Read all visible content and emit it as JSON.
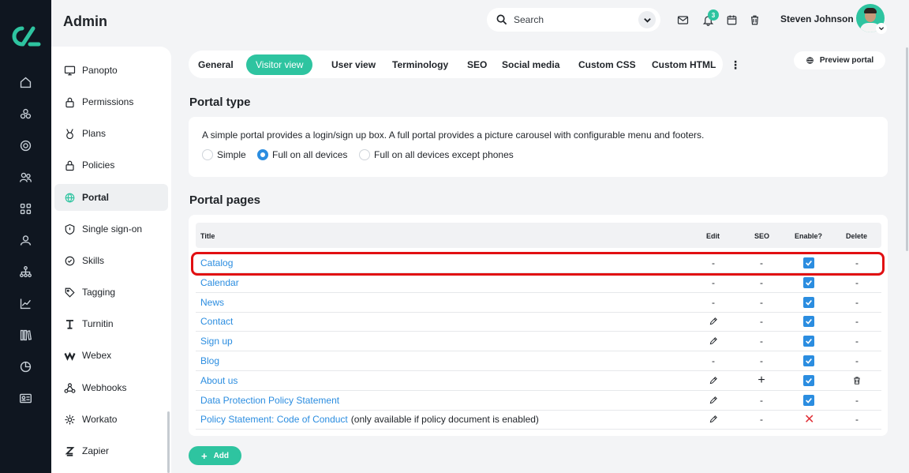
{
  "header": {
    "title": "Admin",
    "search_placeholder": "Search",
    "notifications_count": "3",
    "user_name": "Steven Johnson"
  },
  "rail_icons": [
    "home-icon",
    "courses-icon",
    "target-icon",
    "users-group-icon",
    "grid-icon",
    "user-icon",
    "hierarchy-icon",
    "chart-icon",
    "library-icon",
    "pie-icon",
    "id-card-icon"
  ],
  "sidebar": {
    "items": [
      {
        "label": "Panopto",
        "icon": "monitor-icon"
      },
      {
        "label": "Permissions",
        "icon": "lock-icon"
      },
      {
        "label": "Plans",
        "icon": "trophy-icon"
      },
      {
        "label": "Policies",
        "icon": "lock-icon"
      },
      {
        "label": "Portal",
        "icon": "globe-icon",
        "active": true
      },
      {
        "label": "Single sign-on",
        "icon": "shield-icon"
      },
      {
        "label": "Skills",
        "icon": "skills-icon"
      },
      {
        "label": "Tagging",
        "icon": "tag-icon"
      },
      {
        "label": "Turnitin",
        "icon": "turnitin-icon"
      },
      {
        "label": "Webex",
        "icon": "webex-icon"
      },
      {
        "label": "Webhooks",
        "icon": "webhooks-icon"
      },
      {
        "label": "Workato",
        "icon": "gear-icon"
      },
      {
        "label": "Zapier",
        "icon": "zapier-icon"
      }
    ]
  },
  "tabs": [
    {
      "label": "General"
    },
    {
      "label": "Visitor view",
      "active": true
    },
    {
      "label": "User view"
    },
    {
      "label": "Terminology"
    },
    {
      "label": "SEO"
    },
    {
      "label": "Social media"
    },
    {
      "label": "Custom CSS"
    },
    {
      "label": "Custom HTML"
    }
  ],
  "preview_label": "Preview portal",
  "portal_type": {
    "title": "Portal type",
    "description": "A simple portal provides a login/sign up box. A full portal provides a picture carousel with configurable menu and footers.",
    "options": [
      {
        "label": "Simple",
        "selected": false
      },
      {
        "label": "Full on all devices",
        "selected": true
      },
      {
        "label": "Full on all devices except phones",
        "selected": false
      }
    ]
  },
  "portal_pages": {
    "title": "Portal pages",
    "columns": {
      "title": "Title",
      "edit": "Edit",
      "seo": "SEO",
      "enable": "Enable?",
      "delete": "Delete"
    },
    "rows": [
      {
        "title": "Catalog",
        "note": "",
        "edit": "-",
        "seo": "-",
        "enable": "checked",
        "delete": "-"
      },
      {
        "title": "Calendar",
        "note": "",
        "edit": "-",
        "seo": "-",
        "enable": "checked",
        "delete": "-"
      },
      {
        "title": "News",
        "note": "",
        "edit": "-",
        "seo": "-",
        "enable": "checked",
        "delete": "-"
      },
      {
        "title": "Contact",
        "note": "",
        "edit": "pencil",
        "seo": "-",
        "enable": "checked",
        "delete": "-"
      },
      {
        "title": "Sign up",
        "note": "",
        "edit": "pencil",
        "seo": "-",
        "enable": "checked",
        "delete": "-"
      },
      {
        "title": "Blog",
        "note": "",
        "edit": "-",
        "seo": "-",
        "enable": "checked",
        "delete": "-"
      },
      {
        "title": "About us",
        "note": "",
        "edit": "pencil",
        "seo": "+",
        "enable": "checked",
        "delete": "trash"
      },
      {
        "title": "Data Protection Policy Statement",
        "note": "",
        "edit": "pencil",
        "seo": "-",
        "enable": "checked",
        "delete": "-"
      },
      {
        "title": "Policy Statement: Code of Conduct",
        "note": "(only available if policy document is enabled)",
        "edit": "pencil",
        "seo": "-",
        "enable": "cross",
        "delete": "-"
      }
    ],
    "add_label": "Add"
  },
  "colors": {
    "accent": "#2ec4a0",
    "link": "#2b8de0",
    "highlight": "#e10f12",
    "rail": "#0f1620"
  }
}
